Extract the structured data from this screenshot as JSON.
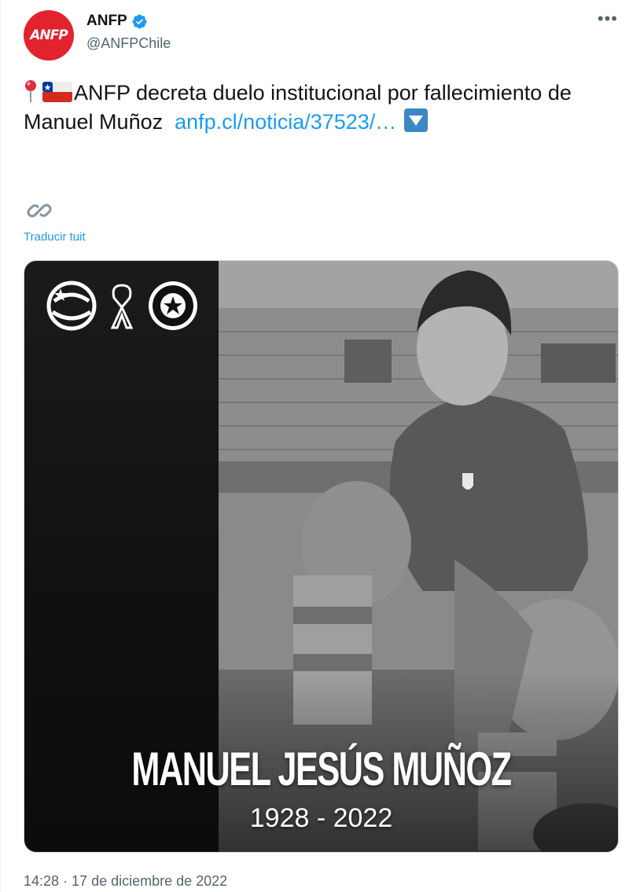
{
  "account": {
    "display_name": "ANFP",
    "handle": "@ANFPChile",
    "avatar_text": "ANFP",
    "verified": true,
    "brand_color": "#e2222d"
  },
  "tweet": {
    "text": "ANFP decreta duelo institucional por fallecimiento de Manuel Muñoz",
    "link_text": "anfp.cl/noticia/37523/…",
    "emojis": [
      "round-pushpin",
      "flag-chile",
      "down-arrow-button"
    ],
    "translate_label": "Traducir tuit",
    "timestamp": "14:28 · 17 de diciembre de 2022"
  },
  "media": {
    "name": "MANUEL JESÚS MUÑOZ",
    "years": "1928 - 2022",
    "logos": [
      "campeonato-logo",
      "mourning-ribbon",
      "federacion-futbol-chile-crest"
    ]
  },
  "colors": {
    "link": "#1d9bf0",
    "secondary_text": "#536471",
    "primary_text": "#0f1419"
  }
}
